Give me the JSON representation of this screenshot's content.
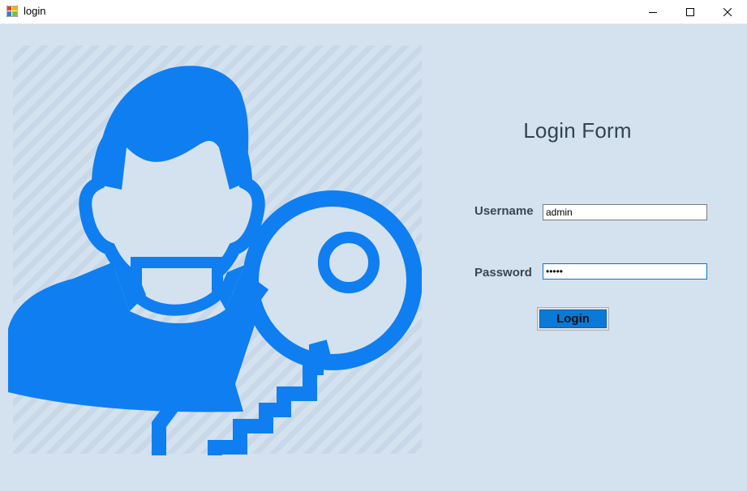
{
  "window": {
    "title": "login",
    "icon": "winforms-app-icon"
  },
  "controls": {
    "minimize_icon": "minimize-icon",
    "maximize_icon": "maximize-icon",
    "close_icon": "close-icon"
  },
  "illustration": {
    "icon": "user-key-icon"
  },
  "form": {
    "title": "Login Form",
    "username_label": "Username",
    "username_value": "admin",
    "password_label": "Password",
    "password_value": "•••••",
    "login_button": "Login"
  },
  "colors": {
    "background": "#d4e2f0",
    "accent": "#0a7ad9",
    "illustration": "#0f7ef0"
  }
}
